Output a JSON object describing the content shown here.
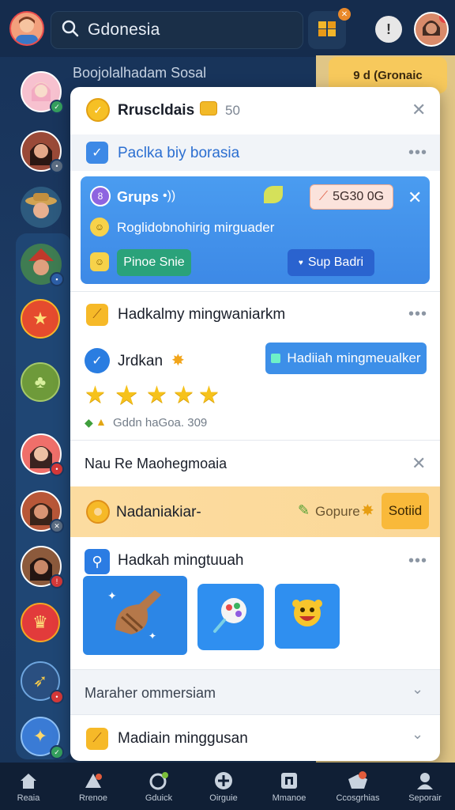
{
  "search": {
    "value": "Gdonesia"
  },
  "background": {
    "heading": "Boojolalhadam Sosal",
    "pill": "9 d (Gronaic"
  },
  "panel": {
    "header": {
      "title": "Rruscldais",
      "count": "50"
    },
    "section1": {
      "title": "Paclka biy borasia"
    },
    "blue_card": {
      "group_label": "Grups",
      "price": "5G30 0G",
      "subtitle": "Roglidobnohirig mirguader",
      "left_button": "Pinoe Snie",
      "right_button": "Sup Badri"
    },
    "section2": {
      "title": "Hadkalmy mingwaniarkm"
    },
    "section3": {
      "name": "Jrdkan",
      "button": "Hadiiah mingmeualker",
      "rating": 5,
      "stat_text": "Gddn haGoa. 309"
    },
    "section4": {
      "title": "Nau Re Maohegmoaia"
    },
    "orange_row": {
      "title": "Nadaniakiar-",
      "chip": "Gopure",
      "button": "Sotiid"
    },
    "section5": {
      "title": "Hadkah mingtuuah"
    },
    "section6": {
      "title": "Maraher ommersiam"
    },
    "section7": {
      "title": "Madiain minggusan"
    }
  },
  "bottom_nav": [
    {
      "label": "Reaia",
      "icon": "home-icon"
    },
    {
      "label": "Rrenoe",
      "icon": "people-icon"
    },
    {
      "label": "Gduick",
      "icon": "refresh-icon"
    },
    {
      "label": "Oirguie",
      "icon": "gamepad-icon"
    },
    {
      "label": "Mmanoe",
      "icon": "frame-icon"
    },
    {
      "label": "Ccosgrhias",
      "icon": "gift-icon"
    },
    {
      "label": "Seporair",
      "icon": "profile-icon"
    }
  ],
  "colors": {
    "accent_blue": "#3d89e6",
    "accent_orange": "#fbd898",
    "green_button": "#2aa27a",
    "nav_bg": "#101f35"
  }
}
